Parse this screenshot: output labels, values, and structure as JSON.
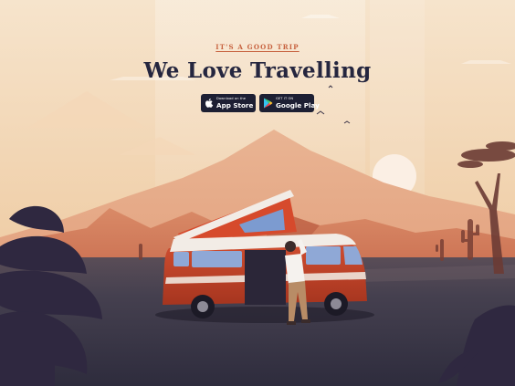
{
  "hero": {
    "eyebrow": "IT'S A GOOD TRIP",
    "title": "We Love Travelling"
  },
  "stores": [
    {
      "name": "app-store",
      "small": "Download on the",
      "big": "App Store",
      "icon": "apple-icon"
    },
    {
      "name": "google-play",
      "small": "GET IT ON",
      "big": "Google Play",
      "icon": "play-icon"
    }
  ],
  "colors": {
    "sky_top": "#f6e4cc",
    "sky_bottom": "#eec6a0",
    "title": "#25263f",
    "accent": "#c7623f",
    "van": "#c9462a",
    "ground": "#3a384a"
  }
}
